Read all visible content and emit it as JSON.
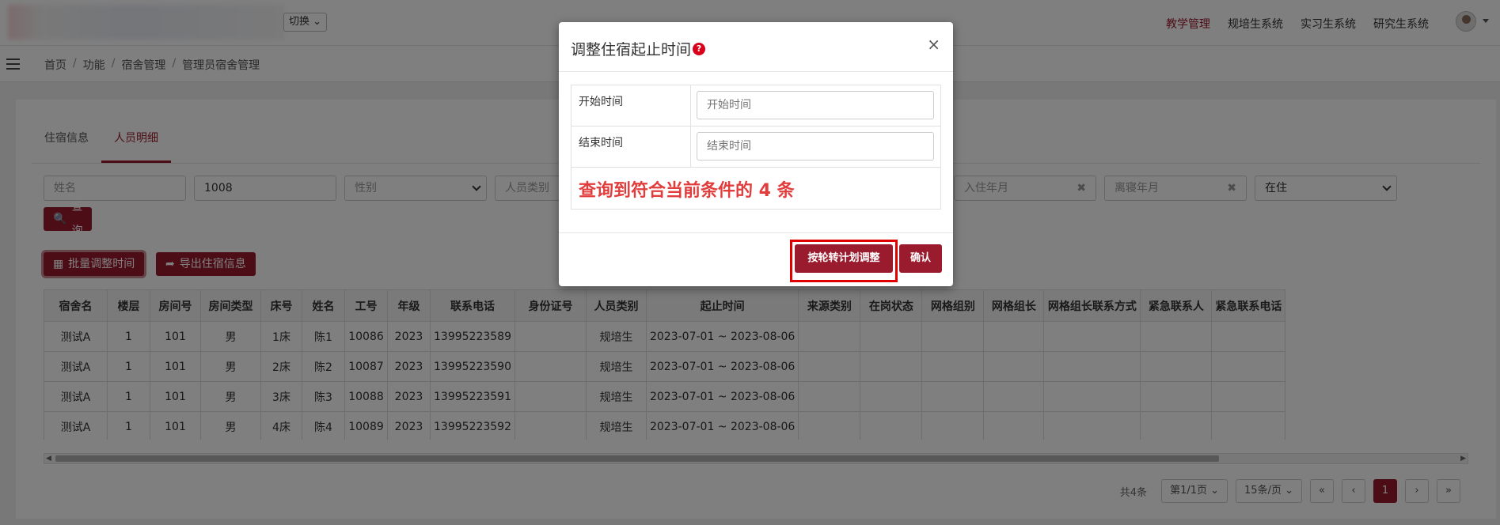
{
  "header": {
    "switch_label": "切换",
    "nav": [
      "教学管理",
      "规培生系统",
      "实习生系统",
      "研究生系统"
    ],
    "active_nav": "教学管理"
  },
  "breadcrumb": [
    "首页",
    "功能",
    "宿舍管理",
    "管理员宿舍管理"
  ],
  "tabs": [
    {
      "label": "住宿信息",
      "active": false
    },
    {
      "label": "人员明细",
      "active": true
    }
  ],
  "filters": {
    "name_placeholder": "姓名",
    "room_value": "1008",
    "gender_placeholder": "性别",
    "category_placeholder": "人员类别",
    "checkin_placeholder": "入住年月",
    "checkout_placeholder": "离寝年月",
    "status_value": "在住",
    "query_label": "查询"
  },
  "actions": {
    "batch_adjust_label": "批量调整时间",
    "export_label": "导出住宿信息"
  },
  "table": {
    "headers": [
      "宿舍名",
      "楼层",
      "房间号",
      "房间类型",
      "床号",
      "姓名",
      "工号",
      "年级",
      "联系电话",
      "身份证号",
      "人员类别",
      "起止时间",
      "来源类别",
      "在岗状态",
      "网格组别",
      "网格组长",
      "网格组长联系方式",
      "紧急联系人",
      "紧急联系电话"
    ],
    "rows": [
      [
        "测试A",
        "1",
        "101",
        "男",
        "1床",
        "陈1",
        "10086",
        "2023",
        "13995223589",
        "",
        "规培生",
        "2023-07-01 ~ 2023-08-06",
        "",
        "",
        "",
        "",
        "",
        "",
        ""
      ],
      [
        "测试A",
        "1",
        "101",
        "男",
        "2床",
        "陈2",
        "10087",
        "2023",
        "13995223590",
        "",
        "规培生",
        "2023-07-01 ~ 2023-08-06",
        "",
        "",
        "",
        "",
        "",
        "",
        ""
      ],
      [
        "测试A",
        "1",
        "101",
        "男",
        "3床",
        "陈3",
        "10088",
        "2023",
        "13995223591",
        "",
        "规培生",
        "2023-07-01 ~ 2023-08-06",
        "",
        "",
        "",
        "",
        "",
        "",
        ""
      ],
      [
        "测试A",
        "1",
        "101",
        "男",
        "4床",
        "陈4",
        "10089",
        "2023",
        "13995223592",
        "",
        "规培生",
        "2023-07-01 ~ 2023-08-06",
        "",
        "",
        "",
        "",
        "",
        "",
        ""
      ]
    ]
  },
  "pagination": {
    "total": "共4条",
    "page_select": "第1/1页",
    "size_select": "15条/页",
    "first": "«",
    "prev": "‹",
    "current": "1",
    "next": "›",
    "last": "»"
  },
  "modal": {
    "title": "调整住宿起止时间",
    "help_glyph": "?",
    "close_glyph": "×",
    "start_label": "开始时间",
    "start_placeholder": "开始时间",
    "end_label": "结束时间",
    "end_placeholder": "结束时间",
    "result_text": "查询到符合当前条件的 4 条",
    "plan_button": "按轮转计划调整",
    "confirm_button": "确认"
  },
  "colors": {
    "brand": "#9b1b2e",
    "result_red": "#e23d3d",
    "highlight_box": "#e00000"
  }
}
